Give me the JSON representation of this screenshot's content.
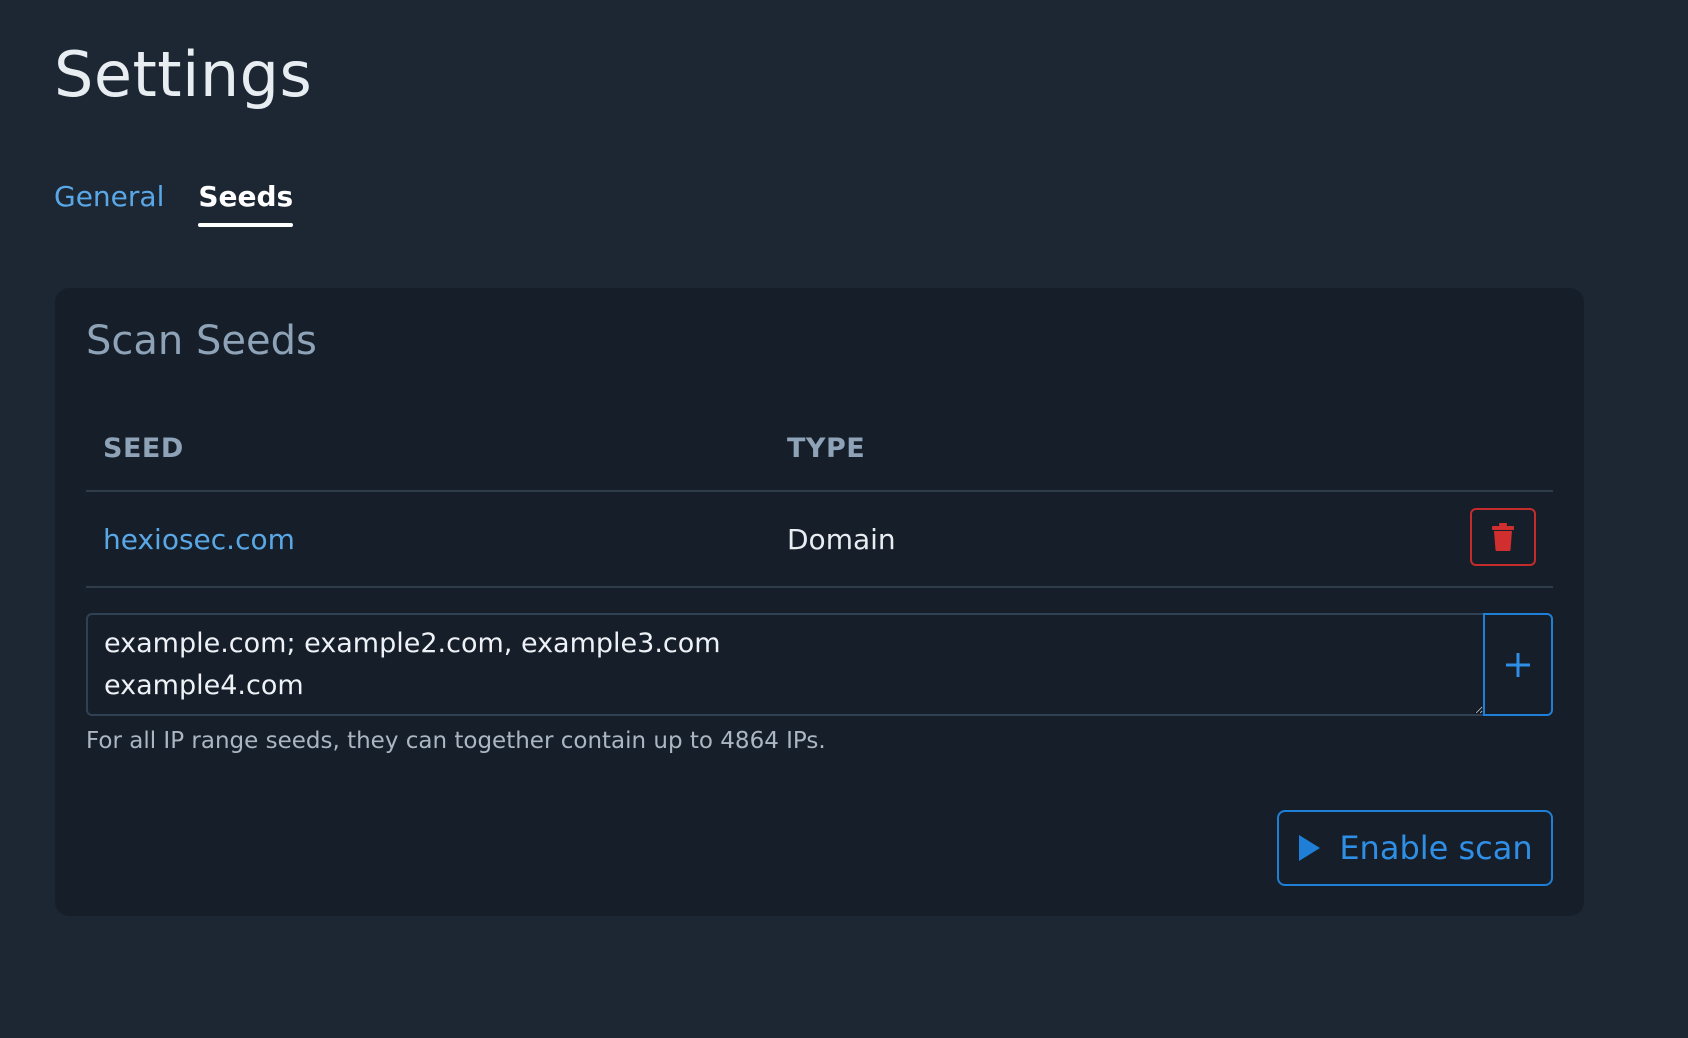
{
  "page": {
    "title": "Settings"
  },
  "tabs": [
    {
      "label": "General",
      "active": false
    },
    {
      "label": "Seeds",
      "active": true
    }
  ],
  "card": {
    "title": "Scan Seeds",
    "table": {
      "columns": [
        "SEED",
        "TYPE"
      ],
      "rows": [
        {
          "seed": "hexiosec.com",
          "type": "Domain"
        }
      ]
    },
    "input": {
      "value": "example.com; example2.com, example3.com\nexample4.com"
    },
    "helper_text": "For all IP range seeds, they can together contain up to 4864 IPs.",
    "enable_button": {
      "label": "Enable scan"
    }
  },
  "icons": {
    "delete": "trash-icon",
    "add": "plus-icon",
    "enable": "play-icon"
  },
  "colors": {
    "background": "#1c2733",
    "card": "#161e29",
    "accent": "#1f7fd6",
    "link": "#5aa7e6",
    "danger": "#c42b2b"
  }
}
